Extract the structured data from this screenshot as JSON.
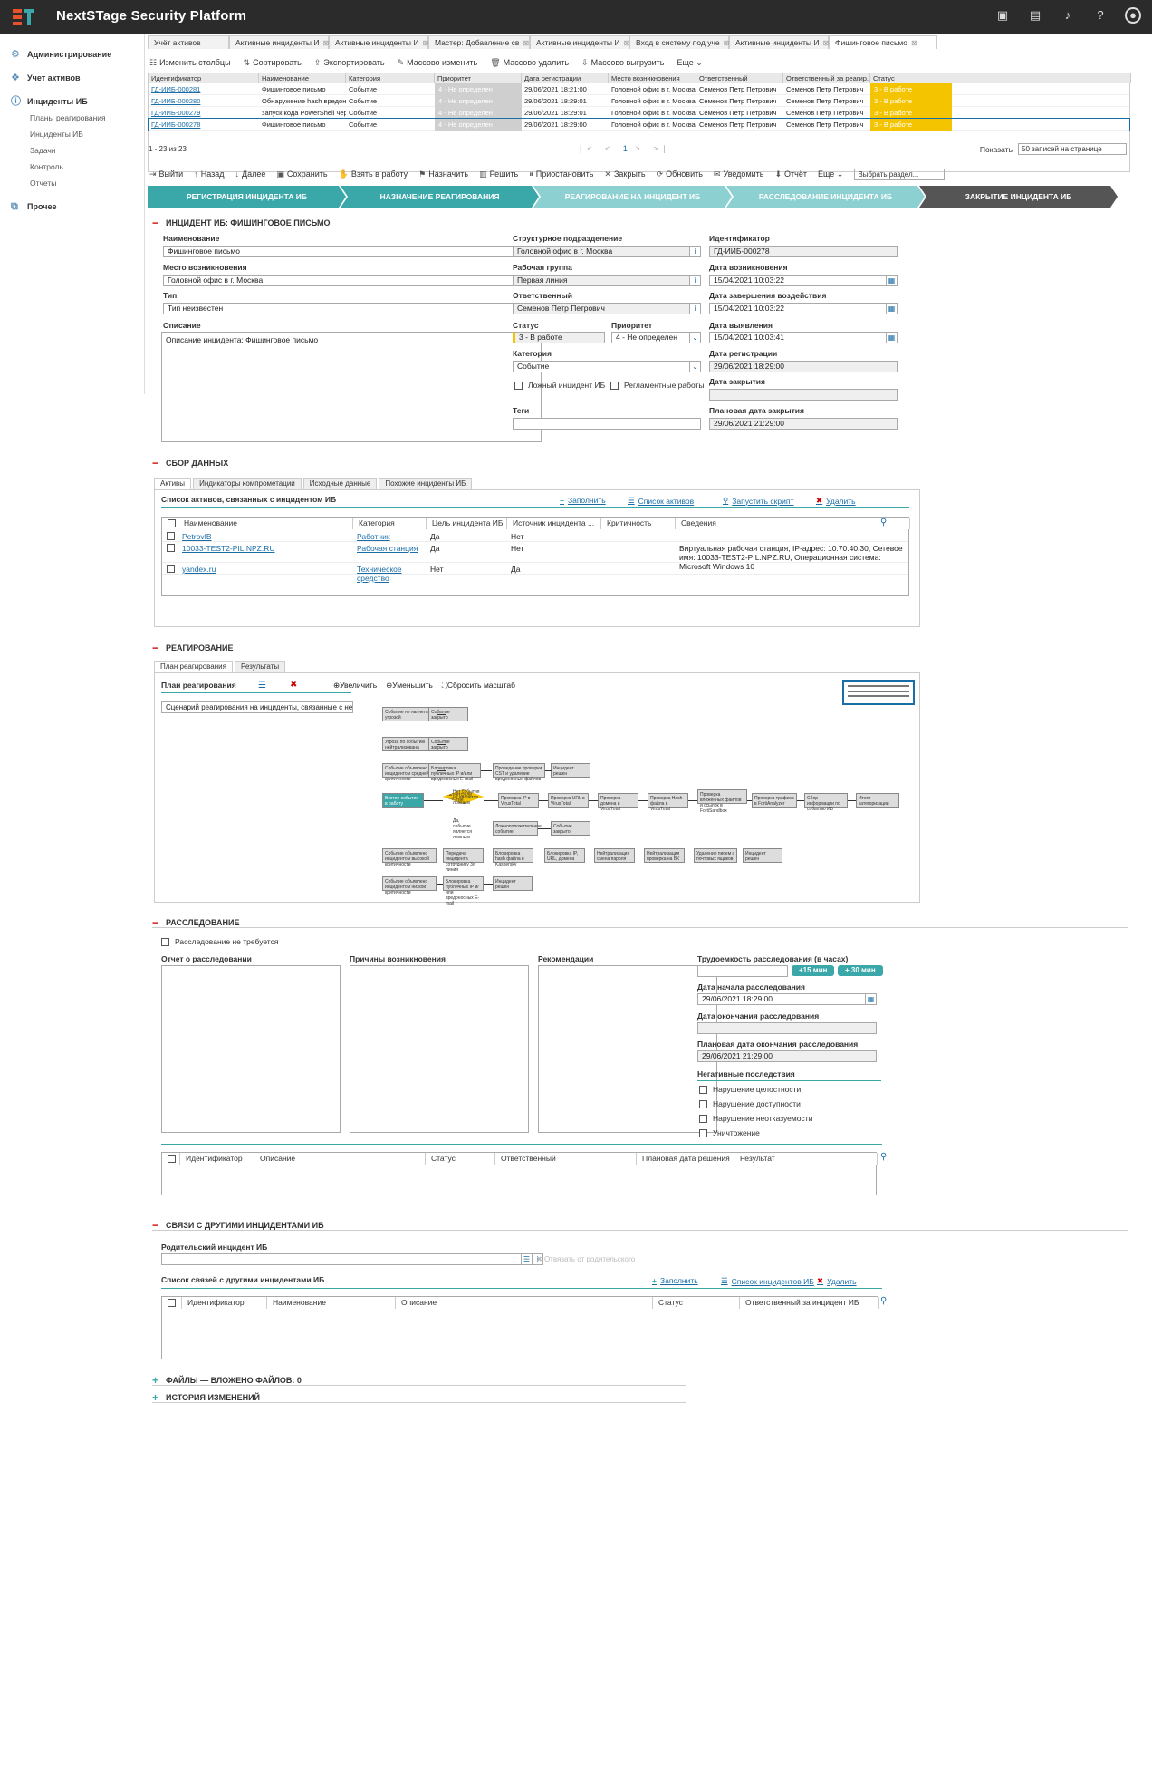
{
  "app": {
    "title": "NextSTage Security Platform"
  },
  "sidebar": {
    "items": [
      {
        "label": "Администрирование"
      },
      {
        "label": "Учет активов"
      },
      {
        "label": "Инциденты ИБ"
      }
    ],
    "subitems": [
      "Планы реагирования",
      "Инциденты ИБ",
      "Задачи",
      "Контроль",
      "Отчеты"
    ],
    "other": "Прочее"
  },
  "tabs": [
    {
      "label": "Учёт активов"
    },
    {
      "label": "Активные инциденты И"
    },
    {
      "label": "Активные инциденты И"
    },
    {
      "label": "Мастер: Добавление св"
    },
    {
      "label": "Активные инциденты И"
    },
    {
      "label": "Вход в систему под уче"
    },
    {
      "label": "Активные инциденты И"
    },
    {
      "label": "Фишинговое письмо"
    }
  ],
  "list_toolbar": [
    "Изменить столбцы",
    "Сортировать",
    "Экспортировать",
    "Массово изменить",
    "Массово удалить",
    "Массово выгрузить",
    "Еще"
  ],
  "list_grid": {
    "columns": [
      "Идентификатор",
      "Наименование",
      "Категория",
      "Приоритет",
      "Дата регистрации",
      "Место возникновения",
      "Ответственный",
      "Ответственный за реагир...",
      "Статус"
    ],
    "rows": [
      [
        "ГД-ИИБ-000281",
        "Фишинговое письмо",
        "Событие",
        "4 - Не определен",
        "29/06/2021 18:21:00",
        "Головной офис в г. Москва",
        "Семенов Петр Петрович",
        "Семенов Петр Петрович",
        "3 - В работе"
      ],
      [
        "ГД-ИИБ-000280",
        "Обнаружение hash вредонос...",
        "Событие",
        "4 - Не определен",
        "29/06/2021 18:29:01",
        "Головной офис в г. Москва",
        "Семенов Петр Петрович",
        "Семенов Петр Петрович",
        "3 - В работе"
      ],
      [
        "ГД-ИИБ-000279",
        "запуск кода PowerShell чере...",
        "Событие",
        "4 - Не определен",
        "29/06/2021 18:29:01",
        "Головной офис в г. Москва",
        "Семенов Петр Петрович",
        "Семенов Петр Петрович",
        "3 - В работе"
      ],
      [
        "ГД-ИИБ-000278",
        "Фишинговое письмо",
        "Событие",
        "4 - Не определен",
        "29/06/2021 18:29:00",
        "Головной офис в г. Москва",
        "Семенов Петр Петрович",
        "Семенов Петр Петрович",
        "3 - В работе"
      ]
    ],
    "pager": "1 - 23 из 23",
    "page": "1",
    "show_label": "Показать",
    "show_value": "50 записей на странице"
  },
  "card_toolbar": [
    "Выйти",
    "Назад",
    "Далее",
    "Сохранить",
    "Взять в работу",
    "Назначить",
    "Решить",
    "Приостановить",
    "Закрыть",
    "Обновить",
    "Уведомить",
    "Отчёт",
    "Еще"
  ],
  "card_toolbar_select": "Выбрать раздел...",
  "process_steps": [
    "РЕГИСТРАЦИЯ ИНЦИДЕНТА ИБ",
    "НАЗНАЧЕНИЕ РЕАГИРОВАНИЯ",
    "РЕАГИРОВАНИЕ НА ИНЦИДЕНТ ИБ",
    "РАССЛЕДОВАНИЕ ИНЦИДЕНТА ИБ",
    "ЗАКРЫТИЕ ИНЦИДЕНТА ИБ"
  ],
  "incident": {
    "section_title": "ИНЦИДЕНТ ИБ: ФИШИНГОВОЕ ПИСЬМО",
    "labels": {
      "name": "Наименование",
      "place": "Место возникновения",
      "type": "Тип",
      "description": "Описание",
      "unit": "Структурное подразделение",
      "group": "Рабочая группа",
      "responsible": "Ответственный",
      "status": "Статус",
      "priority": "Приоритет",
      "category": "Категория",
      "tags": "Теги",
      "id": "Идентификатор",
      "occur_date": "Дата возникновения",
      "impact_end": "Дата завершения воздействия",
      "detect_date": "Дата выявления",
      "reg_date": "Дата регистрации",
      "close_date": "Дата закрытия",
      "plan_close": "Плановая дата закрытия",
      "false_incident": "Ложный инцидент ИБ",
      "routine": "Регламентные работы"
    },
    "values": {
      "name": "Фишинговое письмо",
      "place": "Головной офис в г. Москва",
      "type": "Тип неизвестен",
      "description": "Описание инцидента: Фишинговое письмо",
      "unit": "Головной офис в г. Москва",
      "group": "Первая линия",
      "responsible": "Семенов Петр Петрович",
      "status": "3 - В работе",
      "priority": "4 - Не определен",
      "category": "Событие",
      "tags": "",
      "id": "ГД-ИИБ-000278",
      "occur_date": "15/04/2021 10:03:22",
      "impact_end": "15/04/2021 10:03:22",
      "detect_date": "15/04/2021 10:03:41",
      "reg_date": "29/06/2021 18:29:00",
      "close_date": "",
      "plan_close": "29/06/2021 21:29:00"
    }
  },
  "data_collection": {
    "title": "СБОР ДАННЫХ",
    "tabs": [
      "Активы",
      "Индикаторы компрометации",
      "Исходные данные",
      "Похожие инциденты ИБ"
    ],
    "list_title": "Список активов, связанных с инцидентом ИБ",
    "actions": [
      "Заполнить",
      "Список активов",
      "Запустить скрипт",
      "Удалить"
    ],
    "columns": [
      "Наименование",
      "Категория",
      "Цель инцидента ИБ",
      "Источник инцидента ...",
      "Критичность",
      "Сведения"
    ],
    "rows": [
      [
        "PetrovIB",
        "Работник",
        "Да",
        "Нет",
        "",
        ""
      ],
      [
        "10033-TEST2-PIL.NPZ.RU",
        "Рабочая станция",
        "Да",
        "Нет",
        "",
        "Виртуальная рабочая станция, IP-адрес: 10.70.40.30, Сетевое имя: 10033-TEST2-PIL.NPZ.RU, Операционная система: Microsoft Windows 10"
      ],
      [
        "yandex.ru",
        "Техническое средство",
        "Нет",
        "Да",
        "",
        ""
      ]
    ]
  },
  "response": {
    "title": "РЕАГИРОВАНИЕ",
    "tabs": [
      "План реагирования",
      "Результаты"
    ],
    "plan_label": "План реагирования",
    "plan_value": "Сценарий реагирования на инциденты, связанные с нежелате",
    "zoom": [
      "Увеличить",
      "Уменьшить",
      "Сбросить масштаб"
    ],
    "flow": [
      "Событие не является угрозой",
      "Событие закрыто",
      "Угроза по событию нейтрализована",
      "Событие закрыто",
      "Событие объявлено инцидентом средней критичности",
      "Блокировка публичных IP и/или вредоносных E-mail",
      "Проведение проверки CST и удаление вредоносных файлов",
      "Инцидент решен",
      "Взятие события в работу",
      "Является ли событие ложным срабатыванием?",
      "Проверка IP в VirusTotal",
      "Проверка URL в VirusTotal",
      "Проверка домена в VirusTotal",
      "Проверка Hash файла в VirusTotal",
      "Проверка вложенных файлов и ссылок в FortiSandbox",
      "Проверка трафика в FortiAnalyzer",
      "Сбор информации по событию ИБ",
      "Итоги категоризации",
      "Нет события не является ложным",
      "Да, событие является ложным",
      "Ложноположительное событие",
      "Событие закрыто",
      "Событие объявлено инцидентом высокой критичности",
      "Передача инцидента сотруднику 3я линия",
      "Блокировка hash файла в Kaspersky",
      "Блокировка IP, URL, домена",
      "Нейтрализация смена пароля",
      "Нейтрализация проверка на ВК",
      "Удаление писем с почтовых ящиков",
      "Инцидент решен",
      "Событие объявлено инцидентом низкой критичности",
      "Блокировка публичных IP и/или вредоносных E-mail",
      "Инцидент решен"
    ]
  },
  "investigation": {
    "title": "РАССЛЕДОВАНИЕ",
    "not_required": "Расследование не требуется",
    "report": "Отчет о расследовании",
    "causes": "Причины возникновения",
    "recommendations": "Рекомендации",
    "effort": "Трудоемкость расследования (в часах)",
    "effort_value": "",
    "btn15": "+15 мин",
    "btn30": "+ 30 мин",
    "start_date": "Дата начала расследования",
    "start_value": "29/06/2021 18:29:00",
    "end_date": "Дата окончания расследования",
    "end_value": "",
    "plan_end": "Плановая дата окончания расследования",
    "plan_end_value": "29/06/2021 21:29:00",
    "neg_title": "Негативные последствия",
    "neg": [
      "Нарушение целостности",
      "Нарушение доступности",
      "Нарушение неотказуемости",
      "Уничтожение"
    ],
    "columns": [
      "Идентификатор",
      "Описание",
      "Статус",
      "Ответственный",
      "Плановая дата решения",
      "Результат"
    ]
  },
  "links": {
    "title": "СВЯЗИ С ДРУГИМИ ИНЦИДЕНТАМИ ИБ",
    "parent": "Родительский инцидент ИБ",
    "parent_value": "",
    "detach": "Отвязать от родительского",
    "list_title": "Список связей с другими инцидентами ИБ",
    "actions": [
      "Заполнить",
      "Список инцидентов ИБ",
      "Удалить"
    ],
    "columns": [
      "Идентификатор",
      "Наименование",
      "Описание",
      "Статус",
      "Ответственный за инцидент ИБ"
    ]
  },
  "files": {
    "title": "ФАЙЛЫ — ВЛОЖЕНО ФАЙЛОВ: 0"
  },
  "history": {
    "title": "ИСТОРИЯ ИЗМЕНЕНИЙ"
  },
  "colors": {
    "accent": "#3aa7a9",
    "status": "#f5c400",
    "link": "#1a6ea8",
    "delete": "#cc0000"
  }
}
